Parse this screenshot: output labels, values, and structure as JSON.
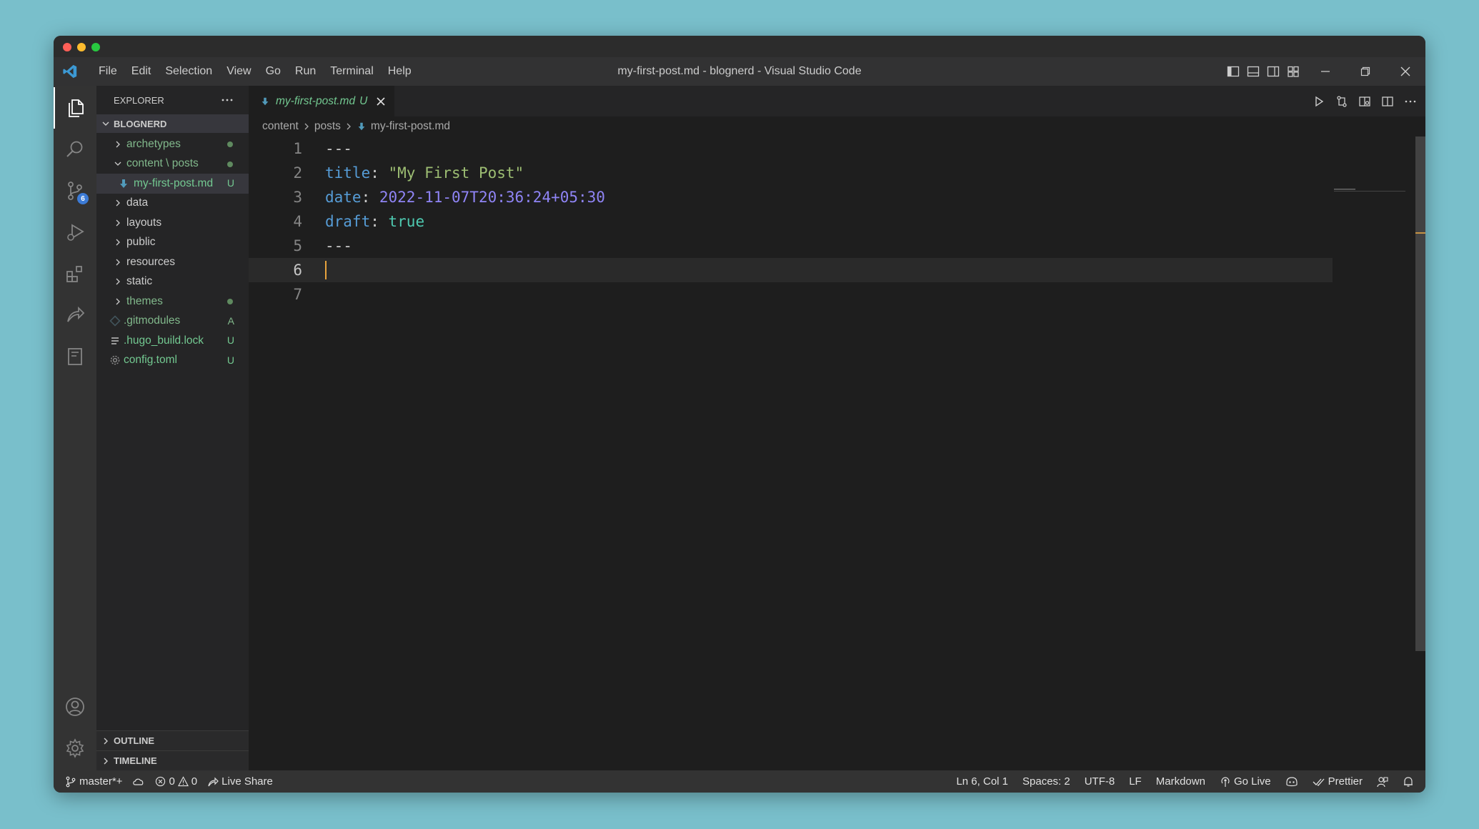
{
  "window": {
    "title": "my-first-post.md - blognerd - Visual Studio Code"
  },
  "menu": {
    "items": [
      "File",
      "Edit",
      "Selection",
      "View",
      "Go",
      "Run",
      "Terminal",
      "Help"
    ]
  },
  "activity_bar": {
    "source_control_badge": "6"
  },
  "explorer": {
    "header": "EXPLORER",
    "root": "BLOGNERD",
    "items": [
      {
        "label": "archetypes",
        "status": "dot"
      },
      {
        "label": "content \\ posts",
        "status": "dot"
      },
      {
        "label": "my-first-post.md",
        "status": "U"
      },
      {
        "label": "data",
        "status": ""
      },
      {
        "label": "layouts",
        "status": ""
      },
      {
        "label": "public",
        "status": ""
      },
      {
        "label": "resources",
        "status": ""
      },
      {
        "label": "static",
        "status": ""
      },
      {
        "label": "themes",
        "status": "dot"
      },
      {
        "label": ".gitmodules",
        "status": "A"
      },
      {
        "label": ".hugo_build.lock",
        "status": "U"
      },
      {
        "label": "config.toml",
        "status": "U"
      }
    ],
    "outline": "OUTLINE",
    "timeline": "TIMELINE"
  },
  "tab": {
    "filename": "my-first-post.md",
    "status": "U"
  },
  "breadcrumb": [
    "content",
    "posts",
    "my-first-post.md"
  ],
  "code": {
    "line_numbers": [
      "1",
      "2",
      "3",
      "4",
      "5",
      "6",
      "7"
    ],
    "line1": "---",
    "line2_key": "title",
    "line2_colon": ": ",
    "line2_value": "\"My First Post\"",
    "line3_key": "date",
    "line3_colon": ": ",
    "line3_value": "2022-11-07T20:36:24+05:30",
    "line4_key": "draft",
    "line4_colon": ": ",
    "line4_value": "true",
    "line5": "---",
    "current_line": 6
  },
  "status_bar": {
    "branch": "master*+",
    "errors": "0",
    "warnings": "0",
    "live_share": "Live Share",
    "position": "Ln 6, Col 1",
    "spaces": "Spaces: 2",
    "encoding": "UTF-8",
    "eol": "LF",
    "language": "Markdown",
    "go_live": "Go Live",
    "prettier": "Prettier"
  },
  "colors": {
    "accent_blue": "#3c7bd6",
    "git_untracked": "#73c991",
    "cursor": "#e8a33d"
  }
}
